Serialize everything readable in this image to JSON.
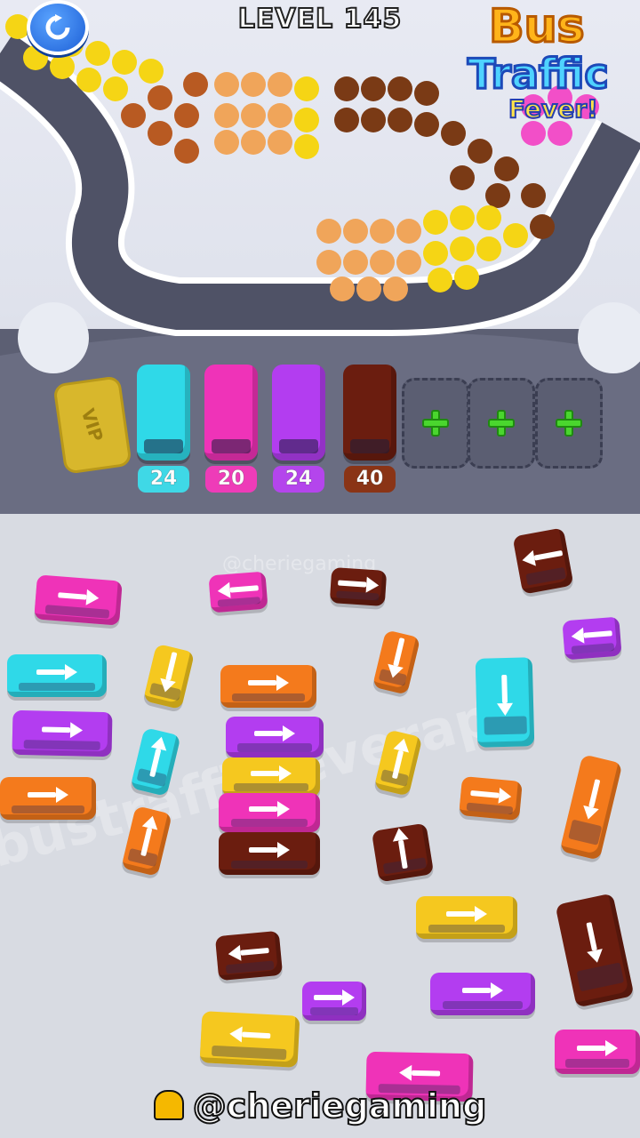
{
  "header": {
    "level_text": "LEVEL 145",
    "restart_icon": "restart-icon"
  },
  "logo": {
    "line1": "Bus",
    "line2": "Traffic",
    "line3": "Fever!"
  },
  "vip_label": "VIP",
  "parked_buses": [
    {
      "color": "#2fd9e8",
      "count": "24",
      "badge": "#3fd8e6"
    },
    {
      "color": "#ef33b8",
      "count": "20",
      "badge": "#ee3cb8"
    },
    {
      "color": "#b33df0",
      "count": "24",
      "badge": "#b445ec"
    },
    {
      "color": "#6b1d0f",
      "count": "40",
      "badge": "#8a3416"
    }
  ],
  "empty_slots": 3,
  "watermark": "@cheriegaming",
  "watermark_diag": "bustrafficfeverapp",
  "handle": "@cheriegaming"
}
